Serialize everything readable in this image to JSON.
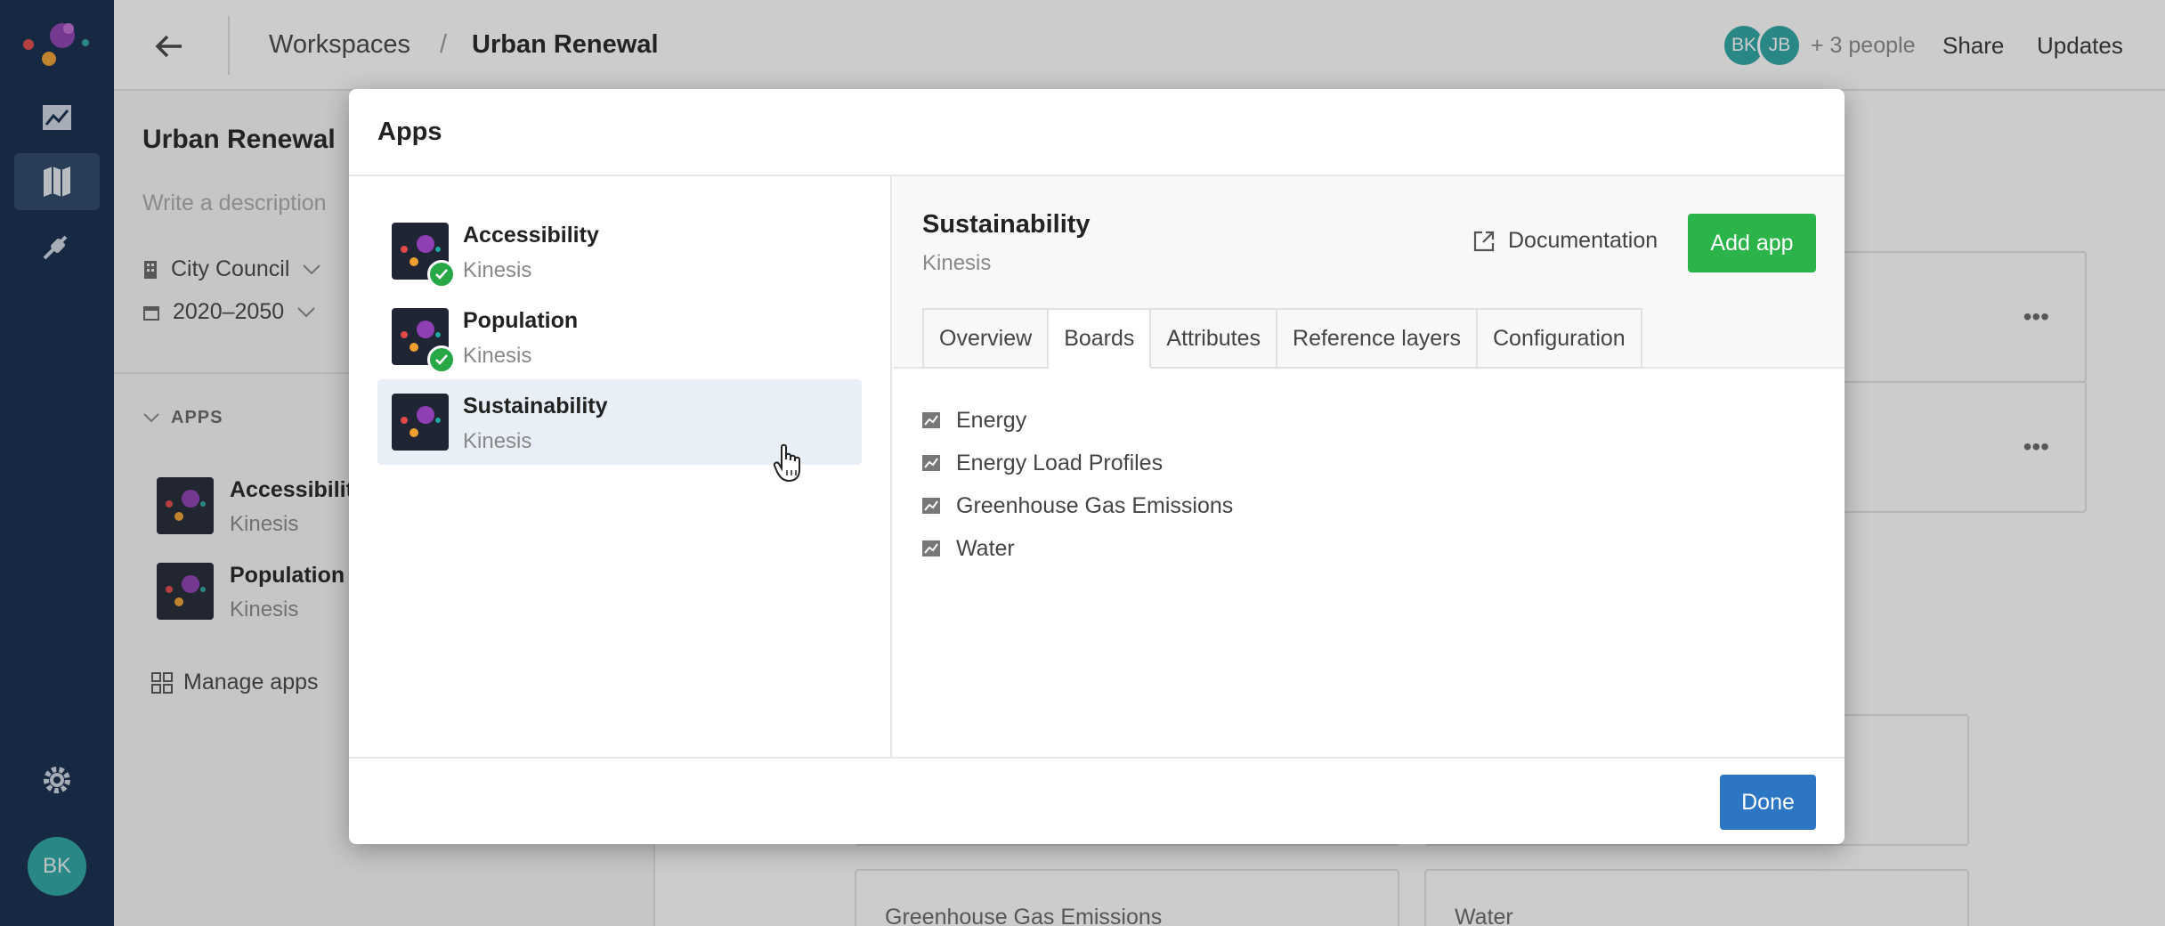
{
  "rail": {
    "items": [
      "chart-icon",
      "map-icon",
      "plug-icon"
    ],
    "settings_icon": "gear-icon",
    "avatar": "BK",
    "colors": {
      "bg": "#12294a",
      "active": "#2b4366",
      "avatar": "#2aa6a2"
    }
  },
  "topbar": {
    "breadcrumb": [
      "Workspaces",
      "/",
      "Urban Renewal"
    ],
    "avatars": [
      "BK",
      "JB"
    ],
    "people": "+ 3 people",
    "share": "Share",
    "updates": "Updates"
  },
  "sidebar": {
    "title": "Urban Renewal",
    "description_placeholder": "Write a description",
    "owner": "City Council",
    "range": "2020–2050",
    "apps_heading": "APPS",
    "apps": [
      {
        "name": "Accessibility",
        "provider": "Kinesis"
      },
      {
        "name": "Population",
        "provider": "Kinesis"
      }
    ],
    "manage": "Manage apps"
  },
  "background_cards": {
    "bottom_left": "Greenhouse Gas Emissions",
    "bottom_right": "Water"
  },
  "modal": {
    "title": "Apps",
    "apps": [
      {
        "name": "Accessibility",
        "provider": "Kinesis",
        "installed": true
      },
      {
        "name": "Population",
        "provider": "Kinesis",
        "installed": true
      },
      {
        "name": "Sustainability",
        "provider": "Kinesis",
        "installed": false
      }
    ],
    "selected": {
      "name": "Sustainability",
      "provider": "Kinesis",
      "documentation": "Documentation",
      "add_app": "Add app",
      "tabs": [
        "Overview",
        "Boards",
        "Attributes",
        "Reference layers",
        "Configuration"
      ],
      "active_tab": "Boards",
      "boards": [
        "Energy",
        "Energy Load Profiles",
        "Greenhouse Gas Emissions",
        "Water"
      ]
    },
    "done": "Done",
    "colors": {
      "add": "#2ab44a",
      "done": "#2c76c4",
      "selected_bg": "#e8eff6",
      "check": "#28a745"
    }
  }
}
